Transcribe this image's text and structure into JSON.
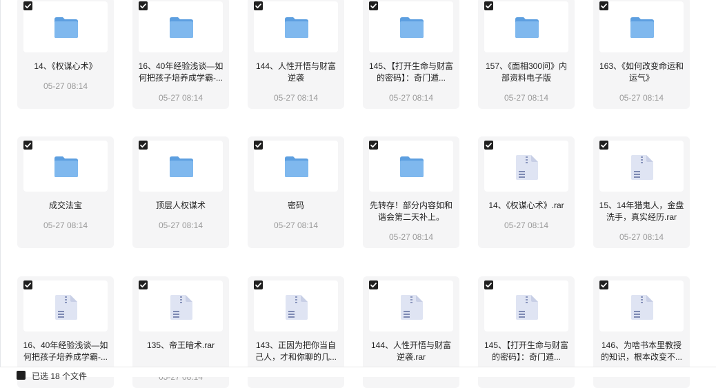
{
  "rows": [
    [
      {
        "name": "14、《权谋心术》",
        "date": "05-27 08:14",
        "type": "folder",
        "selected": true
      },
      {
        "name": "16、40年经验浅谈—如何把孩子培养成学霸-...",
        "date": "05-27 08:14",
        "type": "folder",
        "selected": true
      },
      {
        "name": "144、人性开悟与财富逆袭",
        "date": "05-27 08:14",
        "type": "folder",
        "selected": true
      },
      {
        "name": "145、【打开生命与财富的密码】：奇门遁...",
        "date": "05-27 08:14",
        "type": "folder",
        "selected": true
      },
      {
        "name": "157、《面相300问》内部资料电子版",
        "date": "05-27 08:14",
        "type": "folder",
        "selected": true
      },
      {
        "name": "163、《如何改变命运和运气》",
        "date": "05-27 08:14",
        "type": "folder",
        "selected": true
      }
    ],
    [
      {
        "name": "成交法宝",
        "date": "05-27 08:14",
        "type": "folder",
        "selected": true
      },
      {
        "name": "顶层人权谋术",
        "date": "05-27 08:14",
        "type": "folder",
        "selected": true
      },
      {
        "name": "密码",
        "date": "05-27 08:14",
        "type": "folder",
        "selected": true
      },
      {
        "name": "先转存！部分内容如和谐会第二天补上。",
        "date": "05-27 08:14",
        "type": "folder",
        "selected": true
      },
      {
        "name": "14、《权谋心术》.rar",
        "date": "05-27 08:14",
        "type": "zip",
        "selected": true
      },
      {
        "name": "15、14年猎鬼人，金盘洗手，真实经历.rar",
        "date": "05-27 08:14",
        "type": "zip",
        "selected": true
      }
    ],
    [
      {
        "name": "16、40年经验浅谈—如何把孩子培养成学霸-...",
        "date": "",
        "type": "zip",
        "selected": true
      },
      {
        "name": "135、帝王暗术.rar",
        "date": "05-27 08:14",
        "type": "zip",
        "selected": true
      },
      {
        "name": "143、正因为把你当自己人，才和你聊的几...",
        "date": "",
        "type": "zip",
        "selected": true
      },
      {
        "name": "144、人性开悟与财富逆袭.rar",
        "date": "",
        "type": "zip",
        "selected": true
      },
      {
        "name": "145、【打开生命与财富的密码】：奇门遁...",
        "date": "",
        "type": "zip",
        "selected": true
      },
      {
        "name": "146、为啥书本里教授的知识，根本改变不...",
        "date": "",
        "type": "zip",
        "selected": true
      }
    ]
  ],
  "bottom_bar": {
    "text": "已选 18 个文件"
  },
  "colors": {
    "folder": "#7fb8ee",
    "zip": "#dfe4f3",
    "check": "#1f1f1f"
  }
}
